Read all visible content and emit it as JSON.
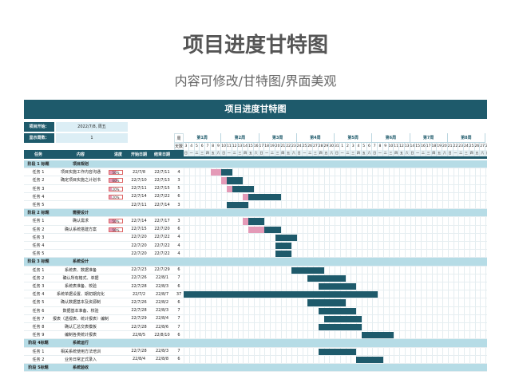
{
  "header": {
    "title": "项目进度甘特图",
    "subtitle": "内容可修改/甘特图/界面美观"
  },
  "sheet": {
    "title": "项目进度甘特图",
    "start_label": "项目开始：",
    "start_value": "2022/7/8, 周五",
    "display_label": "显示周数：",
    "display_value": "1",
    "week_col_label": "周",
    "weekday_col_label": "天数",
    "weeks": [
      "第1周",
      "第2周",
      "第3周",
      "第4周",
      "第5周",
      "第6周",
      "第7周",
      "第8周"
    ],
    "day_numbers": [
      "3",
      "4",
      "5",
      "6",
      "7",
      "8",
      "9",
      "10",
      "11",
      "12",
      "13",
      "14",
      "15",
      "16",
      "17",
      "18",
      "19",
      "20",
      "21",
      "22",
      "23",
      "24",
      "25",
      "26",
      "27",
      "28",
      "29",
      "30",
      "31",
      "1",
      "2",
      "3",
      "4",
      "5",
      "6",
      "7",
      "8",
      "9",
      "10",
      "11",
      "12",
      "13",
      "14",
      "15",
      "16",
      "17",
      "18",
      "19",
      "20",
      "21",
      "22",
      "23",
      "24",
      "25",
      "26",
      "27",
      "28"
    ],
    "day_names": [
      "日",
      "一",
      "二",
      "三",
      "四",
      "五",
      "六",
      "日",
      "一",
      "二",
      "三",
      "四",
      "五",
      "六",
      "日",
      "一",
      "二",
      "三",
      "四",
      "五",
      "六",
      "日",
      "一",
      "二",
      "三",
      "四",
      "五",
      "六",
      "日",
      "一",
      "二",
      "三",
      "四",
      "五",
      "六",
      "日",
      "一",
      "二",
      "三",
      "四",
      "五",
      "六",
      "日",
      "一",
      "二",
      "三",
      "四",
      "五",
      "六",
      "日",
      "一",
      "二",
      "三",
      "四",
      "五",
      "六",
      "日"
    ],
    "columns": {
      "task": "任务",
      "content": "内容",
      "progress": "进度",
      "start": "开始日期",
      "end": "结束日期"
    },
    "rows": [
      {
        "type": "phase",
        "task": "阶段 1 标题",
        "content": "项目规划"
      },
      {
        "type": "task",
        "task": "任务 1",
        "content": "项目实施工作内容沟通",
        "progress": 50,
        "progress_text": "50%",
        "start": "22/7/8",
        "end": "22/7/11",
        "days": "4",
        "bar_start": 5,
        "bar_len": 4,
        "done_len": 2
      },
      {
        "type": "task",
        "task": "任务 2",
        "content": "确定项目实施之计划书",
        "progress": 60,
        "progress_text": "60%",
        "start": "22/7/10",
        "end": "22/7/13",
        "days": "3",
        "bar_start": 7,
        "bar_len": 4,
        "done_len": 1
      },
      {
        "type": "task",
        "task": "任务 3",
        "content": "",
        "progress": 20,
        "progress_text": "20%",
        "start": "22/7/11",
        "end": "22/7/15",
        "days": "5",
        "bar_start": 8,
        "bar_len": 5,
        "done_len": 1
      },
      {
        "type": "task",
        "task": "任务 4",
        "content": "",
        "progress": 20,
        "progress_text": "20%",
        "start": "22/7/14",
        "end": "22/7/22",
        "days": "6",
        "bar_start": 11,
        "bar_len": 7,
        "done_len": 1
      },
      {
        "type": "task",
        "task": "任务 5",
        "content": "",
        "progress": 0,
        "progress_text": "",
        "start": "22/7/11",
        "end": "22/7/14",
        "days": "3",
        "bar_start": 8,
        "bar_len": 4,
        "done_len": 0
      },
      {
        "type": "phase",
        "task": "阶段 2 标题",
        "content": "需要设计"
      },
      {
        "type": "task",
        "task": "任务 1",
        "content": "确认需求",
        "progress": 50,
        "progress_text": "50%",
        "start": "22/7/14",
        "end": "22/7/17",
        "days": "3",
        "bar_start": 11,
        "bar_len": 4,
        "done_len": 1
      },
      {
        "type": "task",
        "task": "任务 2",
        "content": "确认系统搭建方案",
        "progress": 50,
        "progress_text": "50%",
        "start": "22/7/15",
        "end": "22/7/20",
        "days": "6",
        "bar_start": 12,
        "bar_len": 6,
        "done_len": 3
      },
      {
        "type": "task",
        "task": "任务 3",
        "content": "",
        "progress": 0,
        "progress_text": "",
        "start": "22/7/20",
        "end": "22/7/22",
        "days": "4",
        "bar_start": 17,
        "bar_len": 4,
        "done_len": 0
      },
      {
        "type": "task",
        "task": "任务 4",
        "content": "",
        "progress": 0,
        "progress_text": "",
        "start": "22/7/20",
        "end": "22/7/22",
        "days": "4",
        "bar_start": 17,
        "bar_len": 3,
        "done_len": 0
      },
      {
        "type": "task",
        "task": "任务 5",
        "content": "",
        "progress": 0,
        "progress_text": "",
        "start": "22/7/20",
        "end": "22/7/22",
        "days": "4",
        "bar_start": 17,
        "bar_len": 3,
        "done_len": 0
      },
      {
        "type": "phase",
        "task": "阶段 3 标题",
        "content": "系统设计"
      },
      {
        "type": "task",
        "task": "任务 1",
        "content": "系统表、数据准备",
        "progress": 0,
        "progress_text": "",
        "start": "22/7/23",
        "end": "22/7/29",
        "days": "6",
        "bar_start": 20,
        "bar_len": 6,
        "done_len": 0
      },
      {
        "type": "task",
        "task": "任务 2",
        "content": "确认所有格式、单据",
        "progress": 0,
        "progress_text": "",
        "start": "22/7/26",
        "end": "22/8/1",
        "days": "7",
        "bar_start": 23,
        "bar_len": 7,
        "done_len": 0
      },
      {
        "type": "task",
        "task": "任务 3",
        "content": "系统表准备、校验",
        "progress": 0,
        "progress_text": "",
        "start": "22/7/28",
        "end": "22/8/3",
        "days": "6",
        "bar_start": 25,
        "bar_len": 7,
        "done_len": 0
      },
      {
        "type": "task",
        "task": "任务 4",
        "content": "系统单据设置、期初期完化",
        "progress": 0,
        "progress_text": "",
        "start": "22/7/2",
        "end": "22/8/7",
        "days": "37",
        "bar_start": 0,
        "bar_len": 36,
        "done_len": 0
      },
      {
        "type": "task",
        "task": "任务 5",
        "content": "确认数据基本及资源制",
        "progress": 0,
        "progress_text": "",
        "start": "22/7/26",
        "end": "22/8/2",
        "days": "6",
        "bar_start": 23,
        "bar_len": 7,
        "done_len": 0
      },
      {
        "type": "task",
        "task": "任务 6",
        "content": "数据基本准备、校验",
        "progress": 0,
        "progress_text": "",
        "start": "22/7/28",
        "end": "22/8/3",
        "days": "7",
        "bar_start": 25,
        "bar_len": 7,
        "done_len": 0
      },
      {
        "type": "task",
        "task": "任务 7",
        "content": "报表（透视表、统计报表）编制",
        "progress": 0,
        "progress_text": "",
        "start": "22/7/29",
        "end": "22/8/4",
        "days": "7",
        "bar_start": 26,
        "bar_len": 7,
        "done_len": 0
      },
      {
        "type": "task",
        "task": "任务 8",
        "content": "确认汇总交表模板",
        "progress": 0,
        "progress_text": "",
        "start": "22/7/28",
        "end": "22/8/6",
        "days": "7",
        "bar_start": 25,
        "bar_len": 8,
        "done_len": 0
      },
      {
        "type": "task",
        "task": "任务 9",
        "content": "编制各类统计报表",
        "progress": 0,
        "progress_text": "",
        "start": "22/8/5",
        "end": "22/8/10",
        "days": "6",
        "bar_start": 33,
        "bar_len": 6,
        "done_len": 0
      },
      {
        "type": "phase",
        "task": "阶段 4标题",
        "content": "系统运行"
      },
      {
        "type": "task",
        "task": "任务 1",
        "content": "相关系统使用方法培训",
        "progress": 0,
        "progress_text": "",
        "start": "22/7/28",
        "end": "22/8/3",
        "days": "7",
        "bar_start": 25,
        "bar_len": 7,
        "done_len": 0
      },
      {
        "type": "task",
        "task": "任务 2",
        "content": "业务日常正式录入",
        "progress": 0,
        "progress_text": "",
        "start": "22/8/4",
        "end": "22/8/8",
        "days": "6",
        "bar_start": 32,
        "bar_len": 5,
        "done_len": 0
      },
      {
        "type": "phase",
        "task": "阶段 5标题",
        "content": "系统验收"
      }
    ]
  }
}
